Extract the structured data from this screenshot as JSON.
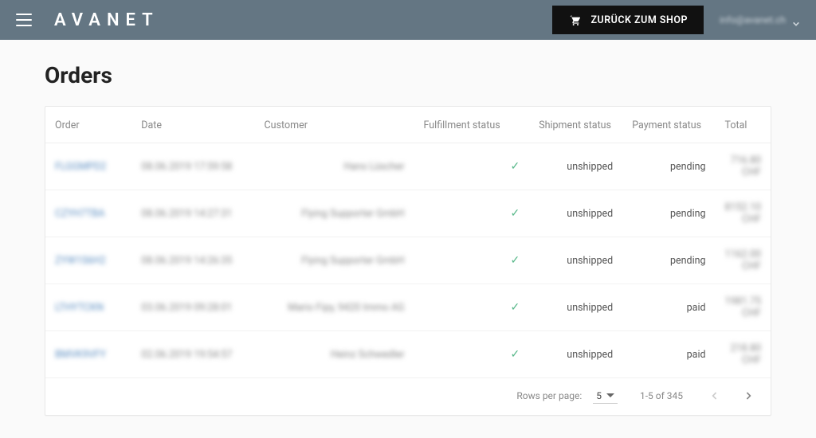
{
  "header": {
    "brand": "AVANET",
    "shop_button": "ZURÜCK ZUM SHOP",
    "account_email": "info@avanet.ch"
  },
  "page": {
    "title": "Orders"
  },
  "table": {
    "columns": {
      "order": "Order",
      "date": "Date",
      "customer": "Customer",
      "fulfillment": "Fulfillment status",
      "shipment": "Shipment status",
      "payment": "Payment status",
      "total": "Total"
    },
    "rows": [
      {
        "order": "FLGGMPD2",
        "date": "08.06.2019 17:59:58",
        "customer": "Hans Lüscher",
        "fulfilled": true,
        "shipment": "unshipped",
        "payment": "pending",
        "total": "716.80 CHF"
      },
      {
        "order": "CZYH7TBA",
        "date": "08.06.2019 14:27:31",
        "customer": "Flying Supporter GmbH",
        "fulfilled": true,
        "shipment": "unshipped",
        "payment": "pending",
        "total": "8152.10 CHF"
      },
      {
        "order": "ZYW1S6H2",
        "date": "08.06.2019 14:26:35",
        "customer": "Flying Supporter GmbH",
        "fulfilled": true,
        "shipment": "unshipped",
        "payment": "pending",
        "total": "1162.00 CHF"
      },
      {
        "order": "LTHYTCKN",
        "date": "03.06.2019 09:28:01",
        "customer": "Mario Fipy, 9420 Immo AG",
        "fulfilled": true,
        "shipment": "unshipped",
        "payment": "paid",
        "total": "1981.75 CHF"
      },
      {
        "order": "BMVK9VFY",
        "date": "02.06.2019 19:54:57",
        "customer": "Heinz Schwedler",
        "fulfilled": true,
        "shipment": "unshipped",
        "payment": "paid",
        "total": "218.80 CHF"
      }
    ]
  },
  "pagination": {
    "rows_per_page_label": "Rows per page:",
    "rows_per_page_value": "5",
    "range": "1-5 of 345"
  }
}
